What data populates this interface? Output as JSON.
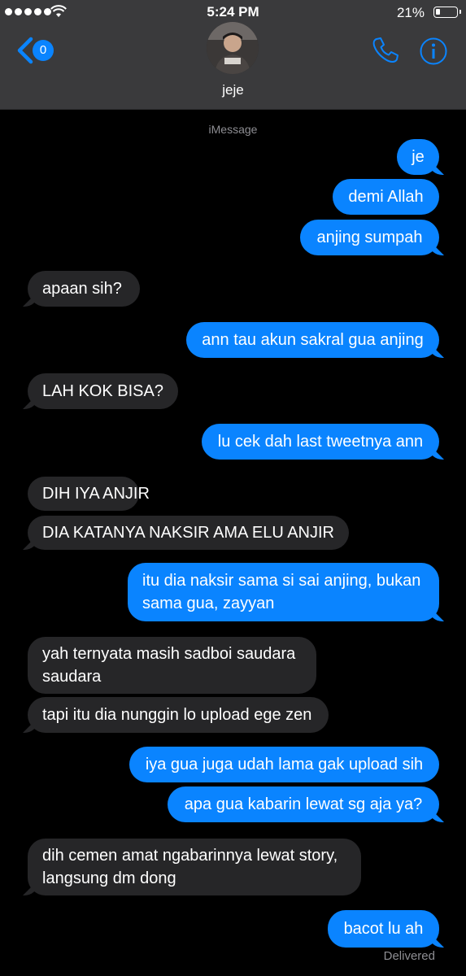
{
  "status_bar": {
    "time": "5:24 PM",
    "battery_percent": "21%",
    "battery_level": 0.21,
    "signal_dots": 5
  },
  "nav": {
    "back_badge": "0",
    "contact_name": "jeje",
    "phone_icon": "phone-icon",
    "info_icon": "info-icon"
  },
  "thread": {
    "service_label": "iMessage",
    "messages": [
      {
        "direction": "out",
        "text": "je"
      },
      {
        "direction": "out",
        "text": "demi Allah"
      },
      {
        "direction": "out",
        "text": "anjing sumpah"
      },
      {
        "direction": "in",
        "text": "apaan sih?"
      },
      {
        "direction": "out",
        "text": "ann tau akun sakral gua anjing"
      },
      {
        "direction": "in",
        "text": "LAH KOK BISA?"
      },
      {
        "direction": "out",
        "text": "lu cek dah last tweetnya ann"
      },
      {
        "direction": "in",
        "text": "DIH IYA ANJIR"
      },
      {
        "direction": "in",
        "text": "DIA KATANYA NAKSIR AMA ELU ANJIR"
      },
      {
        "direction": "out",
        "text": "itu dia naksir sama si sai anjing, bukan sama gua, zayyan"
      },
      {
        "direction": "in",
        "text": "yah ternyata masih sadboi saudara saudara"
      },
      {
        "direction": "in",
        "text": "tapi itu dia nunggin lo upload ege zen"
      },
      {
        "direction": "out",
        "text": "iya gua juga udah lama gak upload sih"
      },
      {
        "direction": "out",
        "text": "apa gua kabarin lewat sg aja ya?"
      },
      {
        "direction": "in",
        "text": "dih cemen amat ngabarinnya lewat story, langsung dm dong"
      },
      {
        "direction": "out",
        "text": "bacot lu ah"
      }
    ],
    "delivery_status": "Delivered"
  },
  "colors": {
    "header_bg": "#3a3a3c",
    "outgoing_bubble": "#0a84ff",
    "incoming_bubble": "#262628",
    "accent": "#0a84ff",
    "secondary_text": "#8e8e93"
  }
}
